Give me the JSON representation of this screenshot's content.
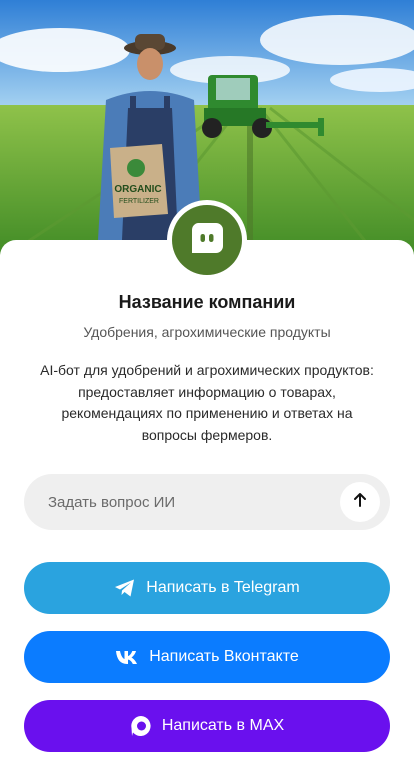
{
  "hero": {
    "bag_text_line1": "ORGANIC",
    "bag_text_line2": "FERTILIZER"
  },
  "company": {
    "name": "Название компании",
    "subtitle": "Удобрения, агрохимические продукты",
    "description": "AI-бот для удобрений и агрохимических продуктов: предоставляет информацию о товарах, рекомендациях по применению и ответах на вопросы фермеров."
  },
  "ask": {
    "placeholder": "Задать вопрос ИИ",
    "value": ""
  },
  "buttons": {
    "telegram": "Написать в Telegram",
    "vk": "Написать Вконтакте",
    "max": "Написать в MAX"
  },
  "colors": {
    "avatar_bg": "#4f7a2a",
    "telegram": "#2aa3df",
    "vk": "#0b7cff",
    "max": "#6a10ee",
    "ask_bg": "#efefef"
  },
  "icons": {
    "avatar": "chat-bot-icon",
    "send": "arrow-up-icon",
    "telegram": "telegram-icon",
    "vk": "vk-icon",
    "max": "max-icon"
  }
}
